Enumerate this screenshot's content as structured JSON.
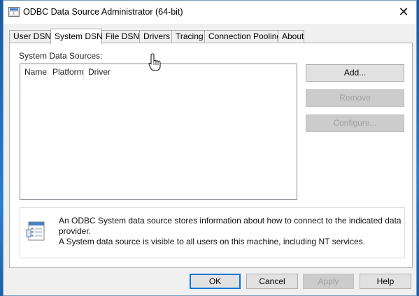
{
  "window": {
    "title": "ODBC Data Source Administrator (64-bit)",
    "close_glyph": "✕"
  },
  "tabs": [
    {
      "label": "User DSN",
      "active": false
    },
    {
      "label": "System DSN",
      "active": true
    },
    {
      "label": "File DSN",
      "active": false
    },
    {
      "label": "Drivers",
      "active": false
    },
    {
      "label": "Tracing",
      "active": false
    },
    {
      "label": "Connection Pooling",
      "active": false
    },
    {
      "label": "About",
      "active": false
    }
  ],
  "panel": {
    "section_label": "System Data Sources:",
    "columns": [
      "Name",
      "Platform",
      "Driver"
    ],
    "rows": [],
    "buttons": {
      "add": {
        "label": "Add...",
        "enabled": true
      },
      "remove": {
        "label": "Remove",
        "enabled": false
      },
      "configure": {
        "label": "Configure...",
        "enabled": false
      }
    },
    "info": {
      "line1": "An ODBC System data source stores information about how to connect to the indicated data provider.",
      "line2": "A System data source is visible to all users on this machine, including NT services."
    }
  },
  "footer": {
    "ok": {
      "label": "OK",
      "enabled": true
    },
    "cancel": {
      "label": "Cancel",
      "enabled": true
    },
    "apply": {
      "label": "Apply",
      "enabled": false
    },
    "help": {
      "label": "Help",
      "enabled": true
    }
  },
  "colors": {
    "accent": "#0078d7",
    "disabled_text": "#a0a0a0"
  }
}
